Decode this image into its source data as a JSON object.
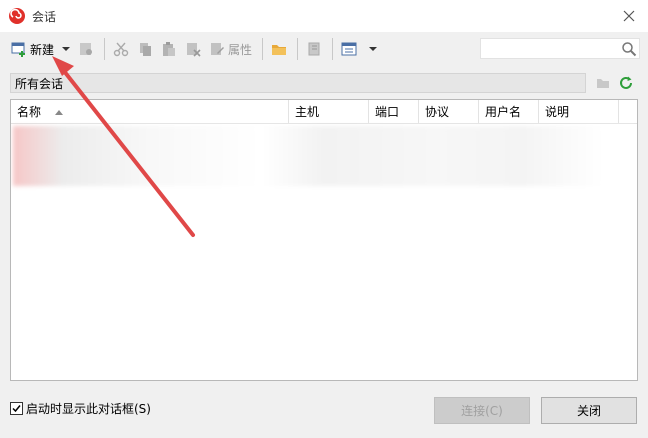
{
  "window": {
    "title": "会话",
    "icon": "snail-logo-icon",
    "accent": "#e0302a"
  },
  "toolbar": {
    "new_label": "新建",
    "properties_label": "属性"
  },
  "search": {
    "value": "",
    "placeholder": ""
  },
  "path": {
    "label": "所有会话"
  },
  "table": {
    "columns": [
      "名称",
      "主机",
      "端口",
      "协议",
      "用户名",
      "说明"
    ],
    "sort_column": "名称",
    "sort_direction": "ascending"
  },
  "footer": {
    "show_on_startup_label": "启动时显示此对话框(S)",
    "show_on_startup_checked": true,
    "connect_label": "连接(C)",
    "close_label": "关闭"
  },
  "annotation": {
    "arrow_color": "#e04848"
  }
}
